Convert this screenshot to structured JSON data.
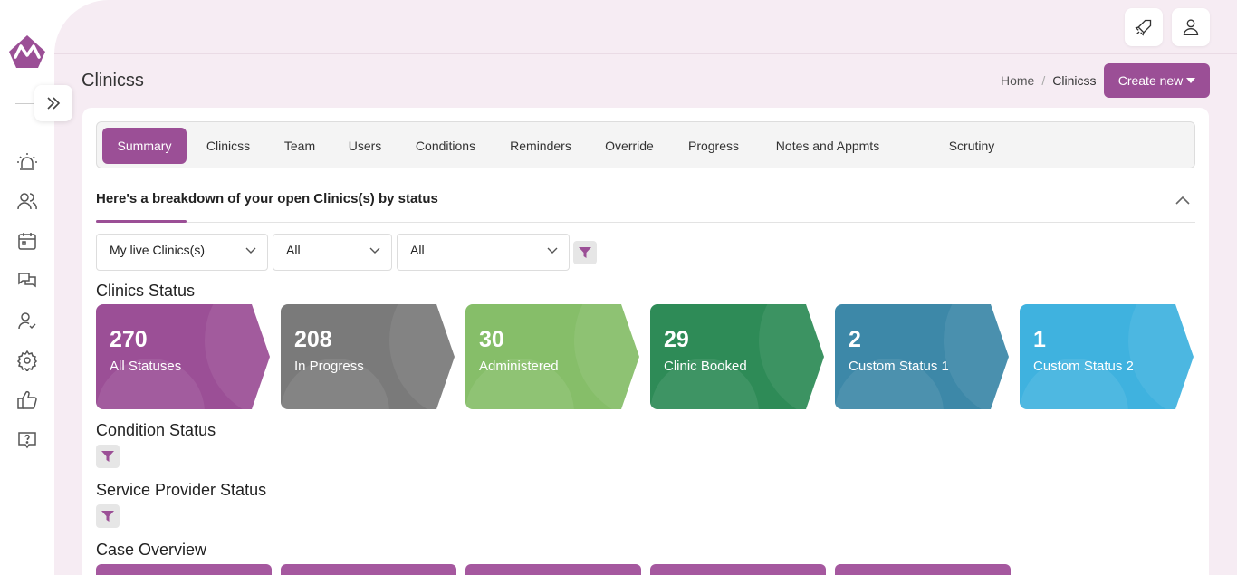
{
  "page": {
    "title": "Clinicss"
  },
  "breadcrumb": {
    "home": "Home",
    "separator": "/",
    "current": "Clinicss"
  },
  "header": {
    "create_label": "Create new"
  },
  "tabs": [
    {
      "label": "Summary",
      "active": true
    },
    {
      "label": "Clinicss"
    },
    {
      "label": "Team"
    },
    {
      "label": "Users"
    },
    {
      "label": "Conditions"
    },
    {
      "label": "Reminders"
    },
    {
      "label": "Override"
    },
    {
      "label": "Progress"
    },
    {
      "label": "Notes and Appmts"
    },
    {
      "label": "Scrutiny"
    }
  ],
  "section": {
    "title": "Here's a breakdown of your open Clinics(s) by status"
  },
  "filters": {
    "scope": "My live Clinics(s)",
    "filter2": "All",
    "filter3": "All"
  },
  "clinics_status": {
    "title": "Clinics Status",
    "tiles": [
      {
        "count": "270",
        "label": "All Statuses",
        "color": "#9b4f96"
      },
      {
        "count": "208",
        "label": "In Progress",
        "color": "#7a7a7a"
      },
      {
        "count": "30",
        "label": "Administered",
        "color": "#86be69"
      },
      {
        "count": "29",
        "label": "Clinic Booked",
        "color": "#2e8b57"
      },
      {
        "count": "2",
        "label": "Custom Status 1",
        "color": "#3d88a8"
      },
      {
        "count": "1",
        "label": "Custom Status 2",
        "color": "#3fb2df"
      }
    ]
  },
  "condition_status": {
    "title": "Condition Status"
  },
  "service_provider_status": {
    "title": "Service Provider Status"
  },
  "case_overview": {
    "title": "Case Overview"
  },
  "icons": {
    "logo": "mountain-logo",
    "rail": [
      "alarm-icon",
      "users-icon",
      "calendar-icon",
      "chat-icon",
      "user-check-icon",
      "gear-icon",
      "thumbs-up-icon",
      "help-chat-icon"
    ],
    "top": [
      "rocket-icon",
      "user-icon"
    ]
  },
  "colors": {
    "brand": "#9b4f96",
    "background": "#f6ecf3"
  }
}
